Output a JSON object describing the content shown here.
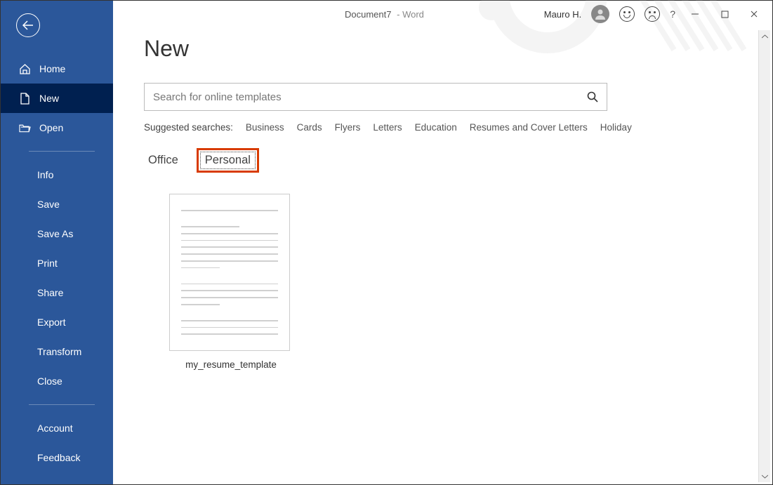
{
  "titlebar": {
    "document": "Document7",
    "app": "Word",
    "username": "Mauro H."
  },
  "sidebar": {
    "home": "Home",
    "new": "New",
    "open": "Open",
    "info": "Info",
    "save": "Save",
    "saveas": "Save As",
    "print": "Print",
    "share": "Share",
    "export": "Export",
    "transform": "Transform",
    "close": "Close",
    "account": "Account",
    "feedback": "Feedback"
  },
  "page": {
    "title": "New",
    "searchPlaceholder": "Search for online templates",
    "suggestedLabel": "Suggested searches:",
    "suggested": [
      "Business",
      "Cards",
      "Flyers",
      "Letters",
      "Education",
      "Resumes and Cover Letters",
      "Holiday"
    ],
    "tabs": {
      "office": "Office",
      "personal": "Personal"
    },
    "template1": "my_resume_template"
  }
}
